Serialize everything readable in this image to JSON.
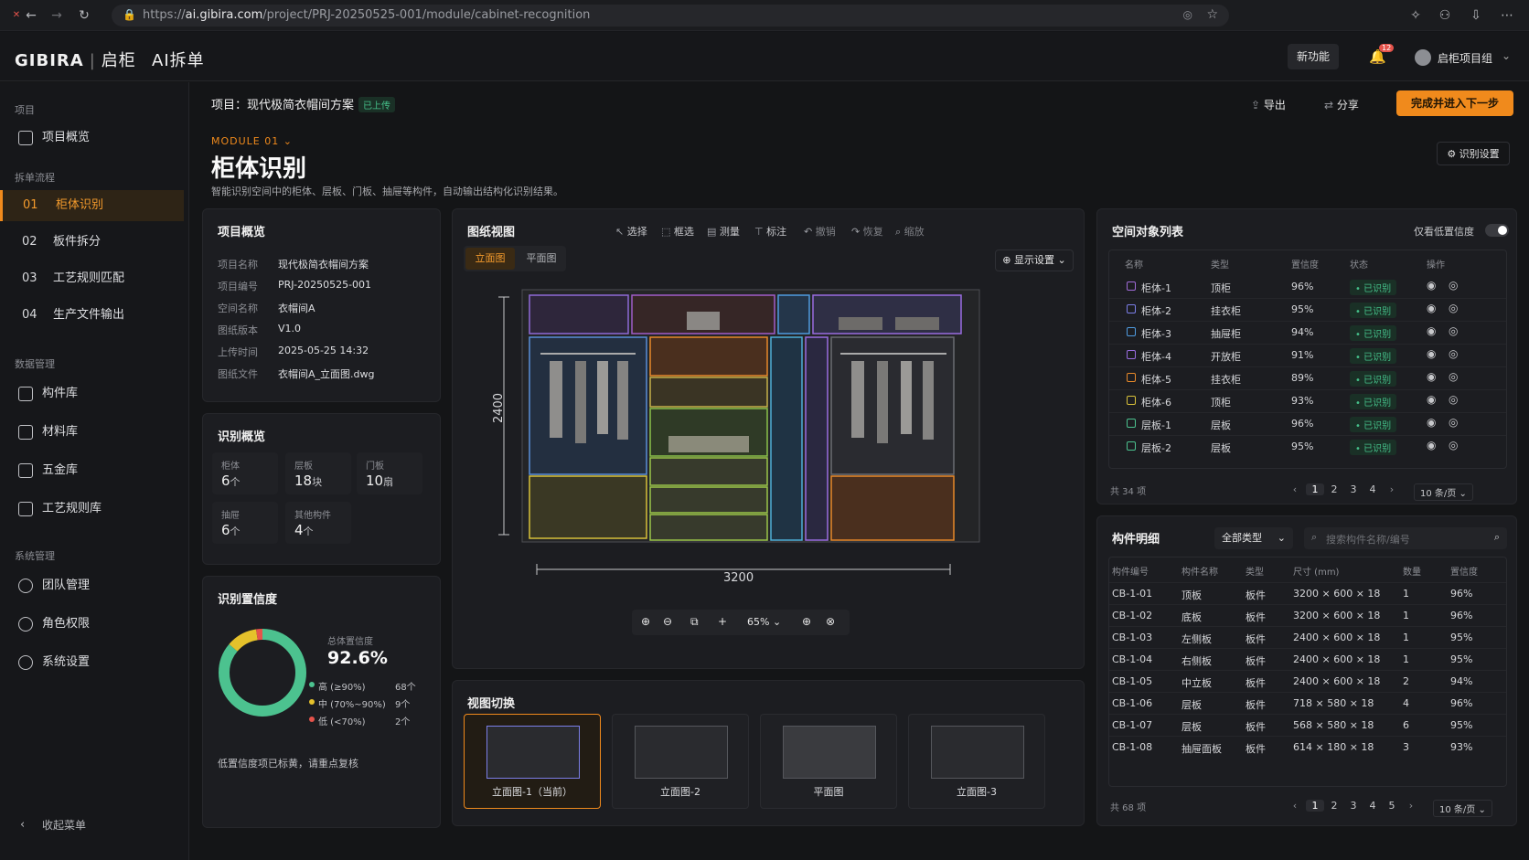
{
  "browser": {
    "url_pre": "https://",
    "url_host": "ai.gibira.com",
    "url_path": "/project/PRJ-20250525-001/module/cabinet-recognition"
  },
  "header": {
    "logo": "GIBIRA",
    "brand_cn": "启柜",
    "app": "AI拆单",
    "new_feature": "新功能",
    "notif_count": "12",
    "user": "启柜项目组"
  },
  "sidebar": {
    "group_project": "项目",
    "project_overview": "项目概览",
    "group_flow": "拆单流程",
    "flow": [
      {
        "num": "01",
        "label": "柜体识别"
      },
      {
        "num": "02",
        "label": "板件拆分"
      },
      {
        "num": "03",
        "label": "工艺规则匹配"
      },
      {
        "num": "04",
        "label": "生产文件输出"
      }
    ],
    "group_data": "数据管理",
    "data": [
      "构件库",
      "材料库",
      "五金库",
      "工艺规则库"
    ],
    "group_sys": "系统管理",
    "sys": [
      "团队管理",
      "角色权限",
      "系统设置"
    ],
    "collapse": "收起菜单"
  },
  "topbar": {
    "project_label": "项目：现代极简衣帽间方案",
    "uploaded": "已上传",
    "export": "导出",
    "share": "分享",
    "next": "完成并进入下一步"
  },
  "page": {
    "module": "MODULE 01",
    "title": "柜体识别",
    "desc": "智能识别空间中的柜体、层板、门板、抽屉等构件，自动输出结构化识别结果。",
    "settings": "识别设置"
  },
  "overview": {
    "title": "项目概览",
    "rows": [
      {
        "k": "项目名称",
        "v": "现代极简衣帽间方案"
      },
      {
        "k": "项目编号",
        "v": "PRJ-20250525-001"
      },
      {
        "k": "空间名称",
        "v": "衣帽间A"
      },
      {
        "k": "图纸版本",
        "v": "V1.0"
      },
      {
        "k": "上传时间",
        "v": "2025-05-25 14:32"
      },
      {
        "k": "图纸文件",
        "v": "衣帽间A_立面图.dwg"
      }
    ]
  },
  "summary": {
    "title": "识别概览",
    "stats": [
      {
        "label": "柜体",
        "value": "6",
        "unit": "个"
      },
      {
        "label": "层板",
        "value": "18",
        "unit": "块"
      },
      {
        "label": "门板",
        "value": "10",
        "unit": "扇"
      },
      {
        "label": "抽屉",
        "value": "6",
        "unit": "个"
      },
      {
        "label": "其他构件",
        "value": "4",
        "unit": "个"
      }
    ]
  },
  "confidence": {
    "title": "识别置信度",
    "total_label": "总体置信度",
    "total": "92.6%",
    "legend": [
      {
        "label": "高 (≥90%)",
        "count": "68个",
        "color": "#4cc28f"
      },
      {
        "label": "中 (70%~90%)",
        "count": "9个",
        "color": "#e5c12b"
      },
      {
        "label": "低 (<70%)",
        "count": "2个",
        "color": "#e5534b"
      }
    ],
    "shares": [
      0.861,
      0.114,
      0.025
    ],
    "note": "低置信度项已标黄，请重点复核"
  },
  "drawing": {
    "title": "图纸视图",
    "tools": [
      "选择",
      "框选",
      "测量",
      "标注",
      "撤销",
      "恢复",
      "缩放"
    ],
    "tab_elev": "立面图",
    "tab_plan": "平面图",
    "display": "显示设置",
    "dim_h": "2400",
    "dim_w": "3200",
    "zoom": "65%"
  },
  "views": {
    "title": "视图切换",
    "items": [
      "立面图-1（当前）",
      "立面图-2",
      "平面图",
      "立面图-3"
    ]
  },
  "objects": {
    "title": "空间对象列表",
    "low_only": "仅看低置信度",
    "headers": [
      "名称",
      "类型",
      "置信度",
      "状态",
      "操作"
    ],
    "rows": [
      {
        "name": "柜体-1",
        "type": "顶柜",
        "conf": "96%",
        "status": "已识别",
        "color": "#a06bd8"
      },
      {
        "name": "柜体-2",
        "type": "挂衣柜",
        "conf": "95%",
        "status": "已识别",
        "color": "#7b7ee8"
      },
      {
        "name": "柜体-3",
        "type": "抽屉柜",
        "conf": "94%",
        "status": "已识别",
        "color": "#4f9be0"
      },
      {
        "name": "柜体-4",
        "type": "开放柜",
        "conf": "91%",
        "status": "已识别",
        "color": "#9a6de0"
      },
      {
        "name": "柜体-5",
        "type": "挂衣柜",
        "conf": "89%",
        "status": "已识别",
        "color": "#e8892a"
      },
      {
        "name": "柜体-6",
        "type": "顶柜",
        "conf": "93%",
        "status": "已识别",
        "color": "#d8c13a"
      },
      {
        "name": "层板-1",
        "type": "层板",
        "conf": "96%",
        "status": "已识别",
        "color": "#4cc28f"
      },
      {
        "name": "层板-2",
        "type": "层板",
        "conf": "95%",
        "status": "已识别",
        "color": "#4cc28f"
      }
    ],
    "total": "共 34 项",
    "pages": [
      "1",
      "2",
      "3",
      "4"
    ],
    "per_page": "10 条/页"
  },
  "parts": {
    "title": "构件明细",
    "filter": "全部类型",
    "search_ph": "搜索构件名称/编号",
    "headers": [
      "构件编号",
      "构件名称",
      "类型",
      "尺寸 (mm)",
      "数量",
      "置信度"
    ],
    "rows": [
      [
        "CB-1-01",
        "顶板",
        "板件",
        "3200 × 600 × 18",
        "1",
        "96%"
      ],
      [
        "CB-1-02",
        "底板",
        "板件",
        "3200 × 600 × 18",
        "1",
        "96%"
      ],
      [
        "CB-1-03",
        "左侧板",
        "板件",
        "2400 × 600 × 18",
        "1",
        "95%"
      ],
      [
        "CB-1-04",
        "右侧板",
        "板件",
        "2400 × 600 × 18",
        "1",
        "95%"
      ],
      [
        "CB-1-05",
        "中立板",
        "板件",
        "2400 × 600 × 18",
        "2",
        "94%"
      ],
      [
        "CB-1-06",
        "层板",
        "板件",
        "718 × 580 × 18",
        "4",
        "96%"
      ],
      [
        "CB-1-07",
        "层板",
        "板件",
        "568 × 580 × 18",
        "6",
        "95%"
      ],
      [
        "CB-1-08",
        "抽屉面板",
        "板件",
        "614 × 180 × 18",
        "3",
        "93%"
      ]
    ],
    "total": "共 68 项",
    "pages": [
      "1",
      "2",
      "3",
      "4",
      "5"
    ],
    "per_page": "10 条/页"
  }
}
